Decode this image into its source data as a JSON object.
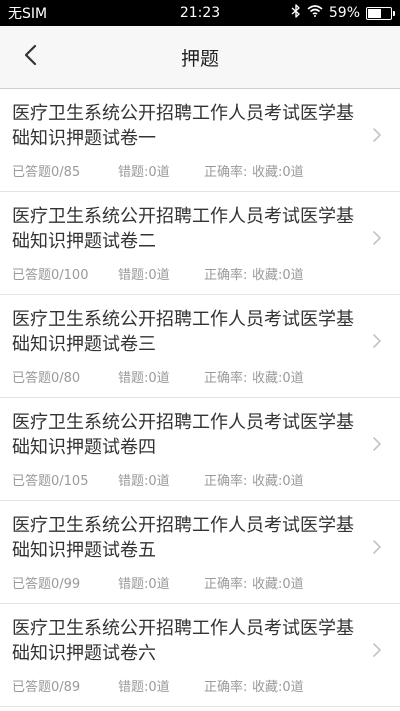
{
  "status_bar": {
    "carrier": "无SIM",
    "time": "21:23",
    "battery": "59%",
    "battery_level": 0.59,
    "icons": [
      "bluetooth-icon",
      "wifi-icon",
      "battery-icon"
    ]
  },
  "header": {
    "title": "押题",
    "back_icon": "chevron-left-icon"
  },
  "papers": [
    {
      "title": "医疗卫生系统公开招聘工作人员考试医学基础知识押题试卷一",
      "answered": "已答题0/85",
      "wrong": "错题:0道",
      "accuracy": "正确率:",
      "favorites": "收藏:0道"
    },
    {
      "title": "医疗卫生系统公开招聘工作人员考试医学基础知识押题试卷二",
      "answered": "已答题0/100",
      "wrong": "错题:0道",
      "accuracy": "正确率:",
      "favorites": "收藏:0道"
    },
    {
      "title": "医疗卫生系统公开招聘工作人员考试医学基础知识押题试卷三",
      "answered": "已答题0/80",
      "wrong": "错题:0道",
      "accuracy": "正确率:",
      "favorites": "收藏:0道"
    },
    {
      "title": "医疗卫生系统公开招聘工作人员考试医学基础知识押题试卷四",
      "answered": "已答题0/105",
      "wrong": "错题:0道",
      "accuracy": "正确率:",
      "favorites": "收藏:0道"
    },
    {
      "title": "医疗卫生系统公开招聘工作人员考试医学基础知识押题试卷五",
      "answered": "已答题0/99",
      "wrong": "错题:0道",
      "accuracy": "正确率:",
      "favorites": "收藏:0道"
    },
    {
      "title": "医疗卫生系统公开招聘工作人员考试医学基础知识押题试卷六",
      "answered": "已答题0/89",
      "wrong": "错题:0道",
      "accuracy": "正确率:",
      "favorites": "收藏:0道"
    }
  ],
  "colors": {
    "status_bar_bg": "#000000",
    "header_bg": "#f7f7f7",
    "title_text": "#333333",
    "meta_text": "#9a9a9a",
    "divider": "#e3e3e3"
  }
}
